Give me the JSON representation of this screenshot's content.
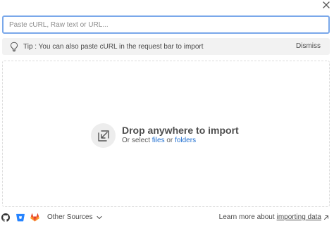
{
  "close_icon": "close-icon",
  "search": {
    "placeholder": "Paste cURL, Raw text or URL...",
    "value": ""
  },
  "tip": {
    "icon": "lightbulb-icon",
    "text": "Tip : You can also paste cURL in the request bar to import",
    "dismiss_label": "Dismiss"
  },
  "drop": {
    "icon": "import-arrow-icon",
    "title": "Drop anywhere to import",
    "sub_prefix": "Or select",
    "files_link": "files",
    "or_text": "or",
    "folders_link": "folders"
  },
  "footer": {
    "sources": [
      "github-icon",
      "bitbucket-icon",
      "gitlab-icon"
    ],
    "other_sources_label": "Other Sources",
    "learn_prefix": "Learn more about",
    "learn_link": "importing data"
  },
  "colors": {
    "accent": "#1f6fd1",
    "input_border": "#7aa8ea",
    "tip_bg": "#f2f2f2",
    "gitlab": "#e24329",
    "bitbucket": "#2684ff"
  }
}
